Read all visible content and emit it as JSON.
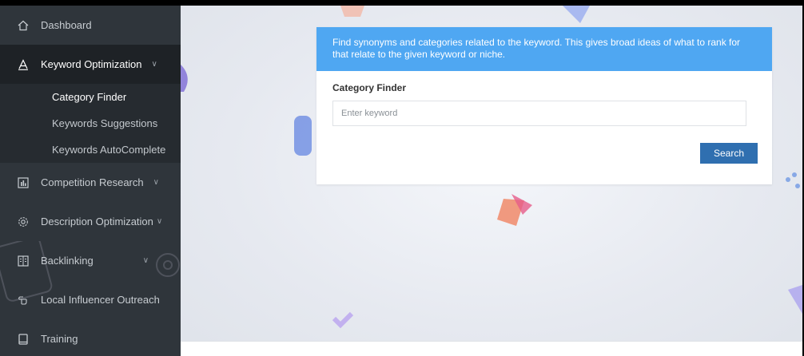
{
  "sidebar": {
    "items": [
      {
        "label": "Dashboard",
        "icon": "home-icon"
      },
      {
        "label": "Keyword Optimization",
        "icon": "letter-a-icon",
        "active": true
      },
      {
        "label": "Competition Research",
        "icon": "bar-chart-icon"
      },
      {
        "label": "Description Optimization",
        "icon": "gear-icon"
      },
      {
        "label": "Backlinking",
        "icon": "columns-icon"
      },
      {
        "label": "Local Influencer Outreach",
        "icon": "pointing-hand-icon"
      },
      {
        "label": "Training",
        "icon": "book-icon"
      }
    ],
    "submenu": [
      {
        "label": "Category Finder",
        "current": true
      },
      {
        "label": "Keywords Suggestions"
      },
      {
        "label": "Keywords AutoComplete"
      }
    ]
  },
  "card": {
    "description": "Find synonyms and categories related to the keyword. This gives broad ideas of what to rank for that relate to the given keyword or niche.",
    "field_label": "Category Finder",
    "input_placeholder": "Enter keyword",
    "input_value": "",
    "search_label": "Search"
  },
  "colors": {
    "sidebar_bg": "#2f353b",
    "sidebar_active": "#1e2226",
    "header_blue": "#4fa7f2",
    "button_blue": "#2f6fb0"
  }
}
